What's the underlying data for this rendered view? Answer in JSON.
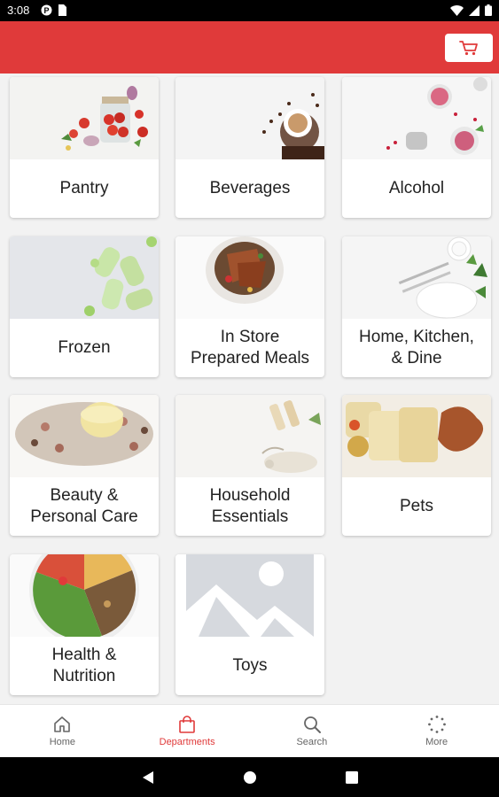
{
  "status_bar": {
    "time": "3:08"
  },
  "colors": {
    "brand_red": "#e03a3a",
    "inactive": "#666666"
  },
  "departments": [
    {
      "label": "Pantry"
    },
    {
      "label": "Beverages"
    },
    {
      "label": "Alcohol"
    },
    {
      "label": "Frozen"
    },
    {
      "label": "In Store\nPrepared Meals"
    },
    {
      "label": "Home, Kitchen,\n& Dine"
    },
    {
      "label": "Beauty &\nPersonal Care"
    },
    {
      "label": "Household\nEssentials"
    },
    {
      "label": "Pets"
    },
    {
      "label": "Health &\nNutrition"
    },
    {
      "label": "Toys"
    }
  ],
  "bottom_nav": {
    "items": [
      {
        "label": "Home",
        "icon": "home-icon"
      },
      {
        "label": "Departments",
        "icon": "shopping-bag-icon",
        "active": true
      },
      {
        "label": "Search",
        "icon": "search-icon"
      },
      {
        "label": "More",
        "icon": "more-icon"
      }
    ]
  }
}
